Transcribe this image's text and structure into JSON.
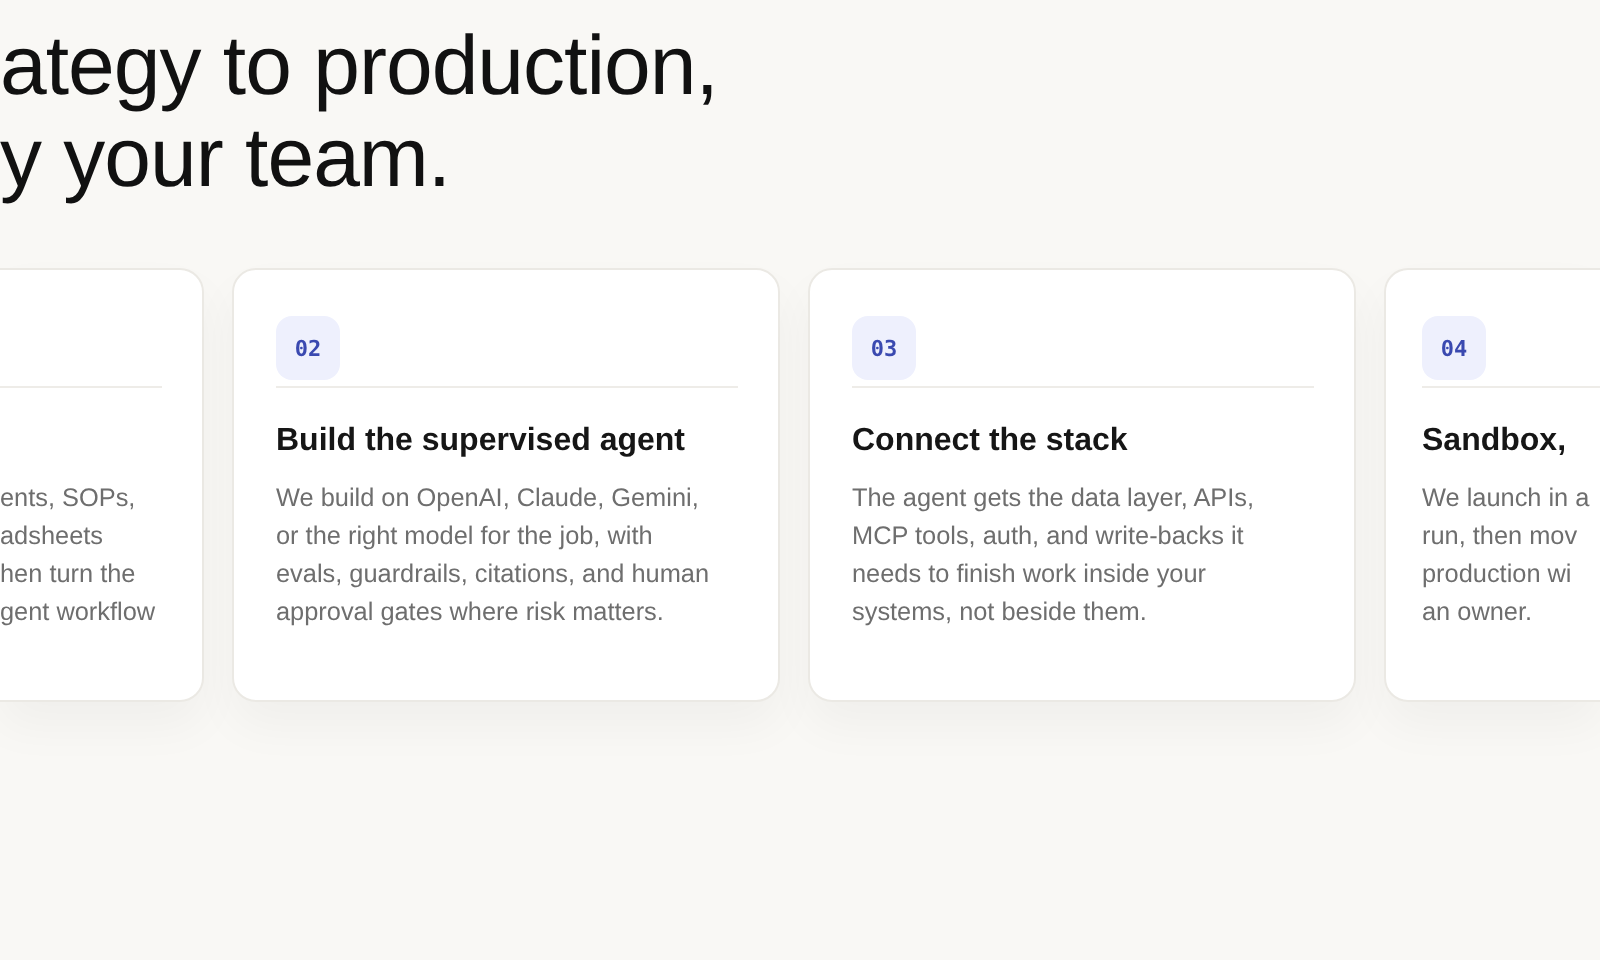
{
  "heading": {
    "lines": [
      "ategy to production,",
      "y your team."
    ]
  },
  "cards": [
    {
      "kind": "cut_left",
      "description_lines": [
        "ents, SOPs,",
        "adsheets",
        "hen turn the",
        "gent workflow"
      ]
    },
    {
      "kind": "full",
      "number": "02",
      "title": "Build the supervised agent",
      "description_lines": [
        "We build on OpenAI, Claude, Gemini,",
        "or the right model for the job, with",
        "evals, guardrails, citations, and human",
        "approval gates where risk matters."
      ]
    },
    {
      "kind": "full",
      "number": "03",
      "title": "Connect the stack",
      "description_lines": [
        "The agent gets the data layer, APIs,",
        "MCP tools, auth, and write-backs it",
        "needs to finish work inside your",
        "systems, not beside them."
      ]
    },
    {
      "kind": "cut_right",
      "number": "04",
      "title": "Sandbox,",
      "description_lines": [
        "We launch in a",
        "run, then mov",
        "production wi",
        "an owner."
      ]
    }
  ]
}
